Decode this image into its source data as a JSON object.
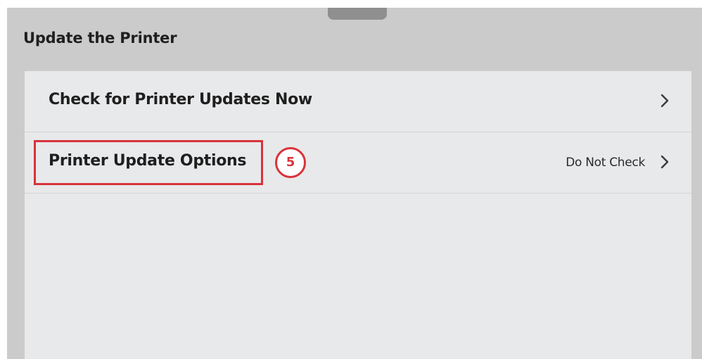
{
  "screen": {
    "title": "Update the Printer"
  },
  "menu": {
    "items": [
      {
        "label": "Check for Printer Updates Now",
        "value": "",
        "icon": "chevron-right-icon"
      },
      {
        "label": "Printer Update Options",
        "value": "Do Not Check",
        "icon": "chevron-right-icon"
      }
    ]
  },
  "annotation": {
    "step_number": "5",
    "color": "#d8333b"
  },
  "colors": {
    "frame_bg": "#cbcbcb",
    "panel_bg": "#e8e9ea",
    "handle": "#8f8f8f"
  }
}
